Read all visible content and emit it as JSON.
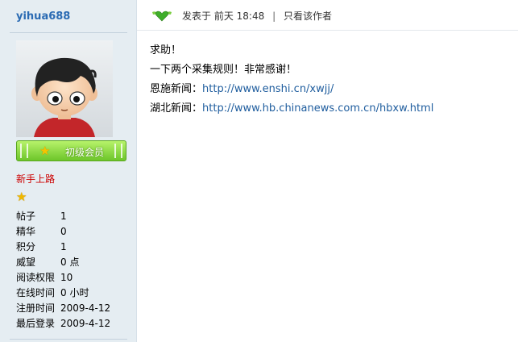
{
  "author": {
    "username": "yihua688",
    "rank_label": "初级会员",
    "group_title": "新手上路",
    "stats": [
      {
        "key": "帖子",
        "value": "1"
      },
      {
        "key": "精华",
        "value": "0"
      },
      {
        "key": "积分",
        "value": "1"
      },
      {
        "key": "威望",
        "value": "0 点"
      },
      {
        "key": "阅读权限",
        "value": "10"
      },
      {
        "key": "在线时间",
        "value": "0 小时"
      },
      {
        "key": "注册时间",
        "value": "2009-4-12"
      },
      {
        "key": "最后登录",
        "value": "2009-4-12"
      }
    ]
  },
  "post": {
    "posted_prefix": "发表于",
    "posted_time": "前天 18:48",
    "separator": "|",
    "author_only_link": "只看该作者",
    "lines": {
      "line1": "求助！",
      "line2": "一下两个采集规则！非常感谢！",
      "label1": "恩施新闻：",
      "url1": "http://www.enshi.cn/xwjj/",
      "label2": "湖北新闻：",
      "url2": "http://www.hb.chinanews.com.cn/hbxw.html"
    }
  },
  "colors": {
    "sidebar_bg": "#e5edf2",
    "username": "#2b6bb3",
    "group_title": "#cc0000",
    "link": "#1f5d9e",
    "rank_badge": "#7ed33a"
  },
  "icons": {
    "online_status": "green-winged-heart-icon",
    "rank_star": "star-icon",
    "group_star": "star-icon"
  }
}
